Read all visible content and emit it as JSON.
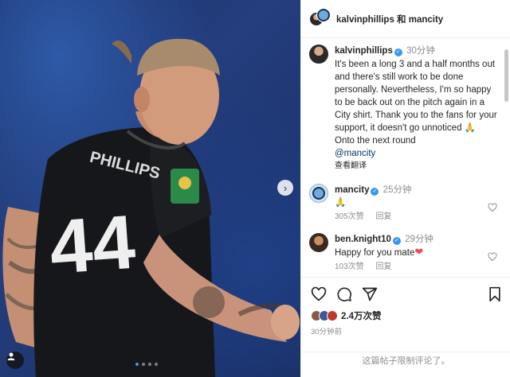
{
  "post": {
    "dual_author": "kalvinphillips 和 mancity",
    "caption": {
      "username": "kalvinphillips",
      "time": "30分钟",
      "text": "It's been a long 3 and a half months out and there's still work to be done personally. Nevertheless, I'm so happy to be back out on the pitch again in a City shirt. Thank you to the fans for your support, it doesn't go unnoticed",
      "emoji": "🙏",
      "text_after": "Onto the next round",
      "mention": "@mancity",
      "translate": "查看翻译"
    },
    "comments": [
      {
        "username": "mancity",
        "time": "25分钟",
        "text": "🙏",
        "likes": "305次赞",
        "reply": "回复"
      },
      {
        "username": "ben.knight10",
        "time": "29分钟",
        "text": "Happy for you mate",
        "emoji": "❤",
        "likes": "103次赞",
        "reply": "回复"
      }
    ],
    "likes_count": "2.4万次赞",
    "posted_ago": "30分钟前",
    "comments_disabled": "这篇帖子限制评论了。"
  },
  "photo": {
    "jersey_number": "44",
    "jersey_name": "PHILLIPS"
  },
  "carousel": {
    "next_glyph": "›"
  },
  "colors": {
    "accent_blue": "#3897f0",
    "heart_red": "#ed4956"
  },
  "icons": [
    "heart-icon",
    "comment-icon",
    "share-icon",
    "save-icon",
    "verified-icon",
    "chevron-right-icon",
    "user-tag-icon"
  ]
}
